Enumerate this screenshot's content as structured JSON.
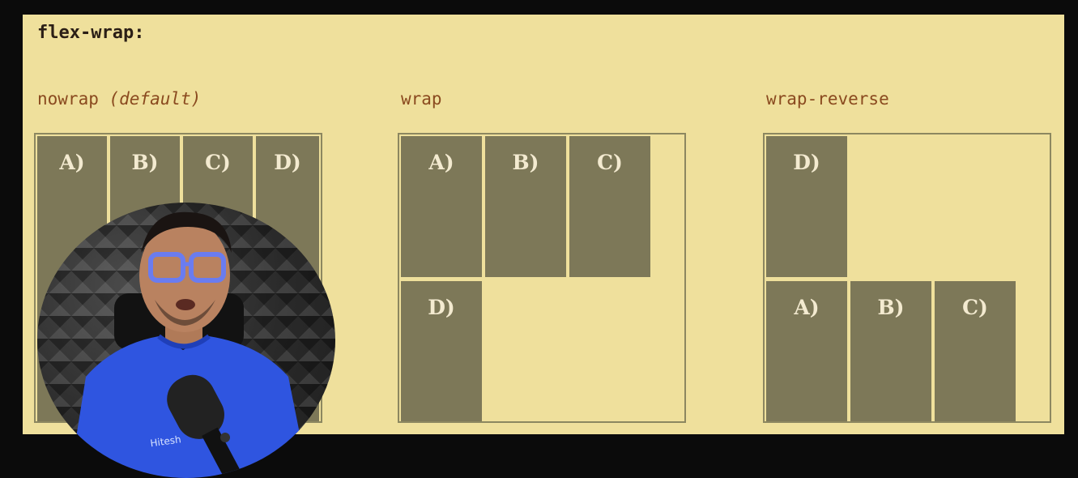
{
  "slide": {
    "heading": "flex-wrap:",
    "panels": [
      {
        "label": "nowrap ",
        "label_em": "(default)",
        "items": [
          "A)",
          "B)",
          "C)",
          "D)"
        ]
      },
      {
        "label": "wrap",
        "label_em": "",
        "items": [
          "A)",
          "B)",
          "C)",
          "D)"
        ]
      },
      {
        "label": "wrap-reverse",
        "label_em": "",
        "items": [
          "D)",
          "A)",
          "B)",
          "C)"
        ]
      }
    ]
  },
  "colors": {
    "background": "#efe09c",
    "item": "#7d7858",
    "border": "#8c8760",
    "heading": "#2b1f16",
    "label": "#8a4a1f"
  },
  "presenter": {
    "shirt_text": "Hitesh"
  }
}
